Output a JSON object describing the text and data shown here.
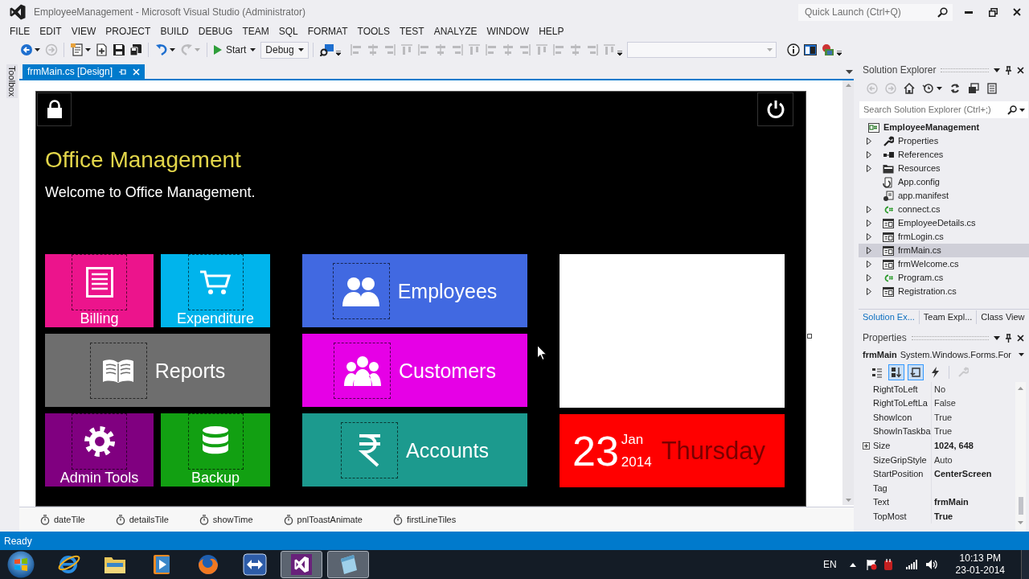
{
  "window": {
    "title": "EmployeeManagement - Microsoft Visual Studio (Administrator)"
  },
  "quick_launch": {
    "placeholder": "Quick Launch (Ctrl+Q)"
  },
  "menu": [
    "FILE",
    "EDIT",
    "VIEW",
    "PROJECT",
    "BUILD",
    "DEBUG",
    "TEAM",
    "SQL",
    "FORMAT",
    "TOOLS",
    "TEST",
    "ANALYZE",
    "WINDOW",
    "HELP"
  ],
  "toolbar": {
    "start": "Start",
    "configuration": "Debug",
    "buttons": [
      {
        "disabled": false
      },
      {
        "disabled": true
      },
      {
        "disabled": false
      },
      {
        "disabled": false
      },
      {
        "disabled": false
      },
      {
        "disabled": false
      },
      {
        "disabled": false
      },
      {
        "disabled": true
      },
      {
        "disabled": false
      },
      {
        "disabled": true
      },
      {
        "disabled": true
      },
      {
        "disabled": true
      },
      {
        "disabled": true
      },
      {
        "disabled": true
      },
      {
        "disabled": true
      },
      {
        "disabled": true
      },
      {
        "disabled": true
      },
      {
        "disabled": true
      },
      {
        "disabled": true
      },
      {
        "disabled": true
      },
      {
        "disabled": true
      },
      {
        "disabled": true
      },
      {
        "disabled": true
      },
      {
        "disabled": true
      },
      {
        "disabled": true
      },
      {
        "disabled": false
      },
      {
        "disabled": false
      },
      {
        "disabled": false
      }
    ]
  },
  "toolbox_tab": "Toolbox",
  "document_tabs": [
    {
      "label": "frmMain.cs [Design]",
      "selected": true
    }
  ],
  "form": {
    "title": "Office Management",
    "subtitle": "Welcome to Office Management.",
    "tile_groups": [
      [
        {
          "kind": "small",
          "label": "Billing",
          "color": "#ec148c"
        },
        {
          "kind": "small",
          "label": "Expenditure",
          "color": "#00b4ec"
        },
        {
          "kind": "wide",
          "label": "Reports",
          "color": "#6e6e6e"
        },
        {
          "kind": "small",
          "label": "Admin Tools",
          "color": "#800080"
        },
        {
          "kind": "small",
          "label": "Backup",
          "color": "#12a012"
        }
      ],
      [
        {
          "kind": "wide",
          "label": "Employees",
          "color": "#4169e1"
        },
        {
          "kind": "wide",
          "label": "Customers",
          "color": "#e600e6"
        },
        {
          "kind": "wide",
          "label": "Accounts",
          "color": "#1c9a8e"
        }
      ],
      [
        {
          "kind": "blank",
          "color": "#ffffff"
        },
        {
          "kind": "date",
          "day": "23",
          "month": "Jan",
          "year": "2014",
          "weekday": "Thursday",
          "color": "#ff0000"
        }
      ]
    ]
  },
  "components": [
    "dateTile",
    "detailsTile",
    "showTime",
    "pnlToastAnimate",
    "firstLineTiles"
  ],
  "solution_explorer": {
    "title": "Solution Explorer",
    "toolbar": [
      {
        "disabled": true
      },
      {
        "disabled": true
      },
      {
        "disabled": false
      },
      {
        "disabled": false
      },
      {
        "disabled": false
      },
      {
        "disabled": false
      },
      {
        "disabled": false
      }
    ],
    "search": {
      "placeholder": "Search Solution Explorer (Ctrl+;)"
    },
    "tree": [
      {
        "kind": "project",
        "label": "EmployeeManagement",
        "selected": false,
        "children": [
          {
            "kind": "properties",
            "label": "Properties",
            "expanded": false,
            "selected": false
          },
          {
            "kind": "references",
            "label": "References",
            "expanded": false,
            "selected": false
          },
          {
            "kind": "folder",
            "label": "Resources",
            "expanded": false,
            "selected": false
          },
          {
            "kind": "config",
            "label": "App.config",
            "selected": false
          },
          {
            "kind": "manifest",
            "label": "app.manifest",
            "selected": false
          },
          {
            "kind": "code",
            "label": "connect.cs",
            "expanded": false,
            "selected": false
          },
          {
            "kind": "form",
            "label": "EmployeeDetails.cs",
            "expanded": false,
            "selected": false
          },
          {
            "kind": "form",
            "label": "frmLogin.cs",
            "expanded": false,
            "selected": false
          },
          {
            "kind": "form",
            "label": "frmMain.cs",
            "expanded": false,
            "selected": true
          },
          {
            "kind": "form",
            "label": "frmWelcome.cs",
            "expanded": false,
            "selected": false
          },
          {
            "kind": "code",
            "label": "Program.cs",
            "expanded": false,
            "selected": false
          },
          {
            "kind": "form",
            "label": "Registration.cs",
            "expanded": false,
            "selected": false
          }
        ]
      }
    ],
    "tabs": [
      {
        "label": "Solution Ex...",
        "selected": true
      },
      {
        "label": "Team Expl...",
        "selected": false
      },
      {
        "label": "Class View",
        "selected": false
      }
    ]
  },
  "properties": {
    "title": "Properties",
    "object": {
      "name": "frmMain",
      "type": "System.Windows.Forms.For"
    },
    "toolbar": [
      {
        "selected": false,
        "disabled": false
      },
      {
        "selected": true,
        "disabled": false
      },
      {
        "selected": true,
        "disabled": false
      },
      {
        "selected": false,
        "disabled": false
      },
      {
        "selected": false,
        "disabled": true
      }
    ],
    "rows": [
      {
        "name": "RightToLeft",
        "value": "No",
        "modified": false,
        "expandable": false
      },
      {
        "name": "RightToLeftLa",
        "value": "False",
        "modified": false,
        "expandable": false
      },
      {
        "name": "ShowIcon",
        "value": "True",
        "modified": false,
        "expandable": false
      },
      {
        "name": "ShowInTaskba",
        "value": "True",
        "modified": false,
        "expandable": false
      },
      {
        "name": "Size",
        "value": "1024, 648",
        "modified": true,
        "expandable": true
      },
      {
        "name": "SizeGripStyle",
        "value": "Auto",
        "modified": false,
        "expandable": false
      },
      {
        "name": "StartPosition",
        "value": "CenterScreen",
        "modified": true,
        "expandable": false
      },
      {
        "name": "Tag",
        "expandable": false
      },
      {
        "name": "Text",
        "value": "frmMain",
        "modified": true,
        "expandable": false
      },
      {
        "name": "TopMost",
        "value": "True",
        "modified": true,
        "expandable": false
      }
    ]
  },
  "status_bar": "Ready",
  "taskbar": {
    "apps": [
      {
        "active": false
      },
      {
        "active": false
      },
      {
        "active": false
      },
      {
        "active": false
      },
      {
        "active": false
      },
      {
        "active": true
      },
      {
        "active": true
      }
    ],
    "language": "EN",
    "time": "10:13 PM",
    "date": "23-01-2014"
  }
}
